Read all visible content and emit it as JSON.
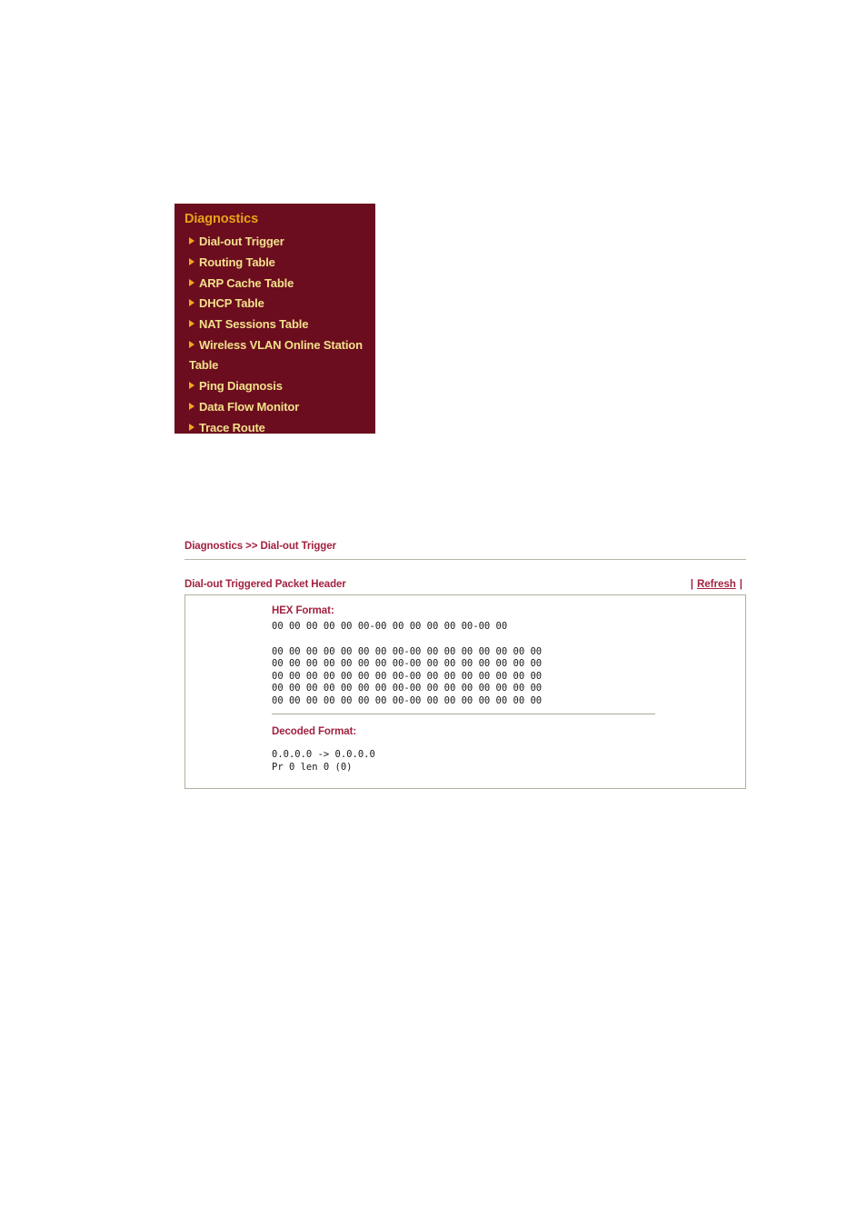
{
  "menu": {
    "title": "Diagnostics",
    "bullet_icon": "triangle-right-icon",
    "bg_color": "#6B0D1E",
    "title_color": "#E8A317",
    "item_color": "#F2E08C",
    "items": [
      {
        "label": "Dial-out Trigger"
      },
      {
        "label": "Routing Table"
      },
      {
        "label": "ARP Cache Table"
      },
      {
        "label": "DHCP Table"
      },
      {
        "label": "NAT Sessions Table"
      },
      {
        "label": "Wireless VLAN Online Station Table"
      },
      {
        "label": "Ping Diagnosis"
      },
      {
        "label": "Data Flow Monitor"
      },
      {
        "label": "Trace Route"
      }
    ]
  },
  "breadcrumb": {
    "text": "Diagnostics >> Dial-out Trigger",
    "color": "#A32240"
  },
  "section": {
    "title": "Dial-out Triggered Packet Header",
    "refresh_label": "Refresh",
    "left_pipe": "|",
    "right_pipe": "|",
    "accent_color": "#A32240"
  },
  "packet": {
    "hex_heading": "HEX Format:",
    "hex_first_line": "00 00 00 00 00 00-00 00 00 00 00 00-00 00",
    "hex_lines": [
      "00 00 00 00 00 00 00 00-00 00 00 00 00 00 00 00",
      "00 00 00 00 00 00 00 00-00 00 00 00 00 00 00 00",
      "00 00 00 00 00 00 00 00-00 00 00 00 00 00 00 00",
      "00 00 00 00 00 00 00 00-00 00 00 00 00 00 00 00",
      "00 00 00 00 00 00 00 00-00 00 00 00 00 00 00 00"
    ],
    "decoded_heading": "Decoded Format:",
    "decoded_lines": [
      "0.0.0.0 -> 0.0.0.0",
      "Pr 0 len 0 (0)"
    ]
  }
}
